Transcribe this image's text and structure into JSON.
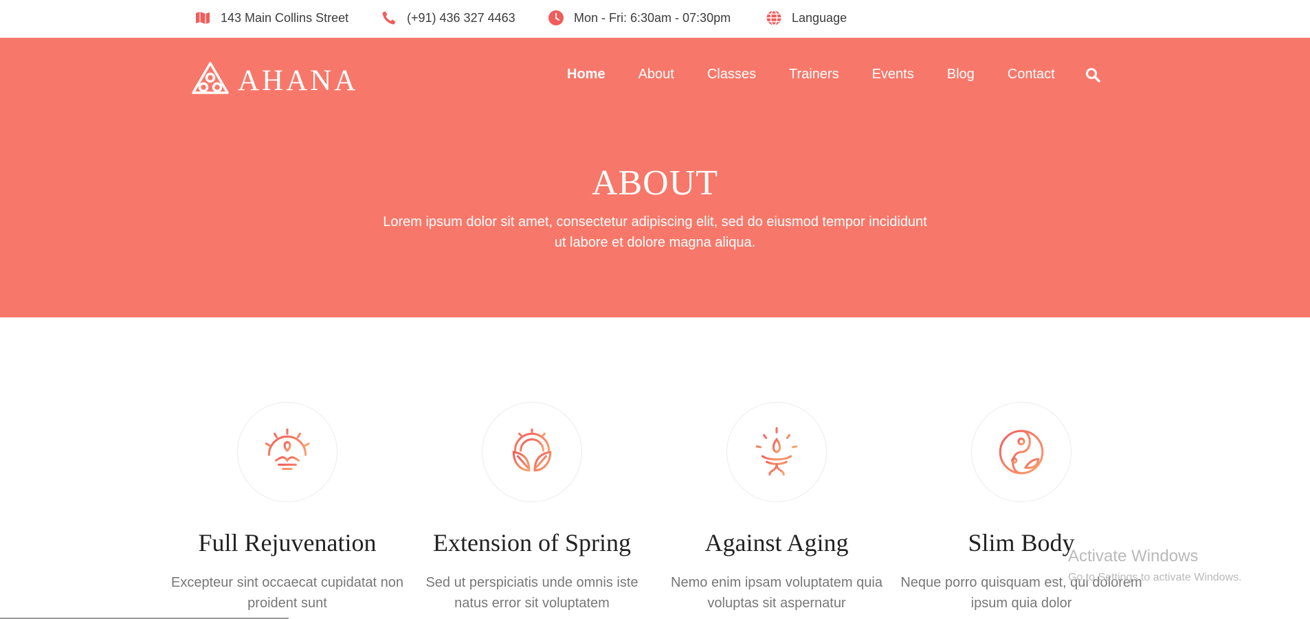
{
  "topbar": {
    "address": "143 Main Collins Street",
    "phone": "(+91) 436 327 4463",
    "hours": "Mon - Fri: 6:30am - 07:30pm",
    "language": "Language",
    "icon_color": "#f25c5c"
  },
  "header": {
    "bg_color": "#f7786a",
    "logo_text": "AHANA",
    "nav": [
      "Home",
      "About",
      "Classes",
      "Trainers",
      "Events",
      "Blog",
      "Contact"
    ],
    "active_nav": "Home"
  },
  "hero": {
    "title": "ABOUT",
    "subtitle": "Lorem ipsum dolor sit amet, consectetur adipiscing elit, sed do eiusmod tempor incididunt ut labore et dolore magna aliqua."
  },
  "features": [
    {
      "title": "Full Rejuvenation",
      "desc": "Excepteur sint occaecat cupidatat non proident sunt",
      "icon": "meditation-sun-icon"
    },
    {
      "title": "Extension of Spring",
      "desc": "Sed ut perspiciatis unde omnis iste natus error sit voluptatem",
      "icon": "sun-leaf-icon"
    },
    {
      "title": "Against Aging",
      "desc": "Nemo enim ipsam voluptatem quia voluptas sit aspernatur",
      "icon": "lotus-drop-icon"
    },
    {
      "title": "Slim Body",
      "desc": "Neque porro quisquam est, qui dolorem ipsum quia dolor",
      "icon": "yin-yang-leaf-icon"
    }
  ],
  "watermark": {
    "line1": "Activate Windows",
    "line2": "Go to Settings to activate Windows."
  }
}
